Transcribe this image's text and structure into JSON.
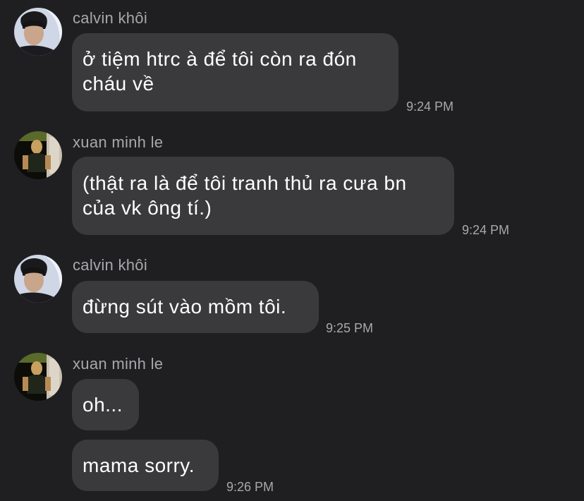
{
  "messages": [
    {
      "sender": "calvin khôi",
      "avatar": "calvin-avatar",
      "lines": [
        "ở tiệm htrc à để tôi còn ra đón",
        "cháu về"
      ],
      "time": "9:24 PM"
    },
    {
      "sender": "xuan minh le",
      "avatar": "xuan-avatar",
      "lines": [
        "(thật ra là để tôi tranh thủ ra cưa bn",
        "của vk ông tí.)"
      ],
      "time": "9:24 PM"
    },
    {
      "sender": "calvin khôi",
      "avatar": "calvin-avatar",
      "lines": [
        "đừng sút vào mồm tôi."
      ],
      "time": "9:25 PM"
    },
    {
      "sender": "xuan minh le",
      "avatar": "xuan-avatar",
      "bubbles": [
        "oh...",
        "mama sorry."
      ],
      "time": "9:26 PM"
    }
  ],
  "colors": {
    "background": "#1f1f21",
    "bubble": "#3a3a3c",
    "message_text": "#ffffff",
    "meta_text": "#a8a8ac"
  }
}
